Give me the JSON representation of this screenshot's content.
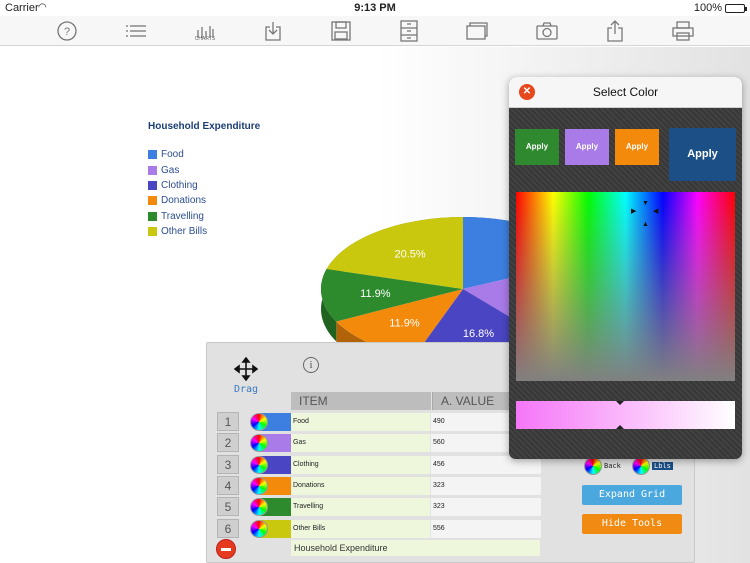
{
  "status": {
    "carrier": "Carrier",
    "time": "9:13 PM",
    "battery": "100%"
  },
  "toolbar": {
    "charts_label": "CHARTS"
  },
  "chart_data": {
    "type": "pie",
    "title": "Household Expenditure",
    "legend": [
      "Food",
      "Gas",
      "Clothing",
      "Donations",
      "Travelling",
      "Other Bills"
    ],
    "colors": [
      "#3d7fe0",
      "#a87be8",
      "#4a45c2",
      "#f48a0c",
      "#2d8a2d",
      "#c9c70e"
    ],
    "values": [
      490,
      560,
      456,
      323,
      323,
      556
    ],
    "visible_labels": [
      "20.5%",
      "11.9%",
      "11.9%",
      "16.8%"
    ]
  },
  "grid": {
    "drag_label": "Drag",
    "col_item": "ITEM",
    "col_value": "A.  VALUE",
    "rows": [
      {
        "num": "1",
        "item": "Food",
        "value": "490",
        "color": "#3d7fe0"
      },
      {
        "num": "2",
        "item": "Gas",
        "value": "560",
        "color": "#a87be8"
      },
      {
        "num": "3",
        "item": "Clothing",
        "value": "456",
        "color": "#4a45c2"
      },
      {
        "num": "4",
        "item": "Donations",
        "value": "323",
        "color": "#f48a0c"
      },
      {
        "num": "5",
        "item": "Travelling",
        "value": "323",
        "color": "#2d8a2d"
      },
      {
        "num": "6",
        "item": "Other Bills",
        "value": "556",
        "color": "#c9c70e"
      }
    ],
    "footer": "Household Expenditure"
  },
  "tools": {
    "back_label": "Back",
    "labels_label": "Lbls",
    "expand_grid": "Expand Grid",
    "hide_tools": "Hide Tools"
  },
  "color_picker": {
    "title": "Select Color",
    "apply_small": "Apply",
    "apply_large": "Apply",
    "preset_colors": [
      "#2f8a2f",
      "#a87be8",
      "#f48a0c"
    ]
  }
}
